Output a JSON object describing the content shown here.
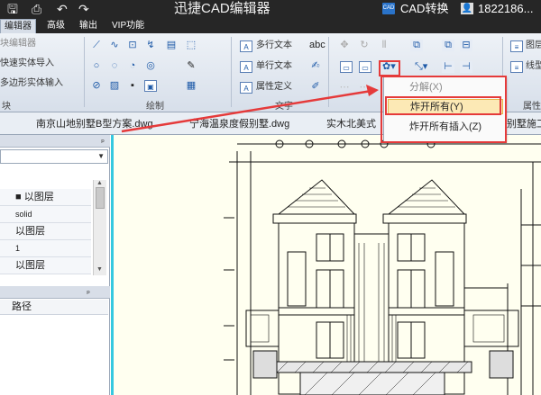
{
  "app": {
    "title": "迅捷CAD编辑器",
    "cad_badge": "CAD",
    "convert": "CAD转换",
    "user_phone": "1822186..."
  },
  "titlebar_icons": [
    "save-icon",
    "print-icon",
    "undo-icon",
    "redo-icon"
  ],
  "menu": {
    "tabs": [
      {
        "label": "编辑器",
        "active": true
      },
      {
        "label": "高级"
      },
      {
        "label": "输出"
      },
      {
        "label": "VIP功能"
      }
    ]
  },
  "ribbon": {
    "left_items": [
      "块编辑器",
      "快速实体导入",
      "多边形实体输入"
    ],
    "left_group": "块",
    "draw_group": "绘制",
    "text_items": [
      "多行文本",
      "单行文本",
      "属性定义"
    ],
    "text_group": "文字",
    "right_items": [
      "图层",
      "线型"
    ],
    "right_group": "属性"
  },
  "context_menu": {
    "items": [
      {
        "label": "分解(X)",
        "disabled": true
      },
      {
        "label": "炸开所有(Y)",
        "highlighted": true
      },
      {
        "label": "炸开所有插入(Z)"
      }
    ]
  },
  "file_tabs": [
    "南京山地别墅B型方案.dwg",
    "宁海温泉度假别墅.dwg",
    "实木北美式",
    "别墅施工"
  ],
  "properties_panel": {
    "pin": "ₚ",
    "rows": [
      {
        "value": "■ 以图层"
      },
      {
        "value": "solid"
      },
      {
        "value": "以图层"
      },
      {
        "value": "1"
      },
      {
        "value": "以图层"
      }
    ]
  },
  "path_panel": {
    "pin": "ₚ",
    "header": "路径"
  },
  "colors": {
    "titlebar": "#262626",
    "accent_red": "#e53a3a",
    "canvas": "#fffff0",
    "highlight": "#fce9b5"
  }
}
